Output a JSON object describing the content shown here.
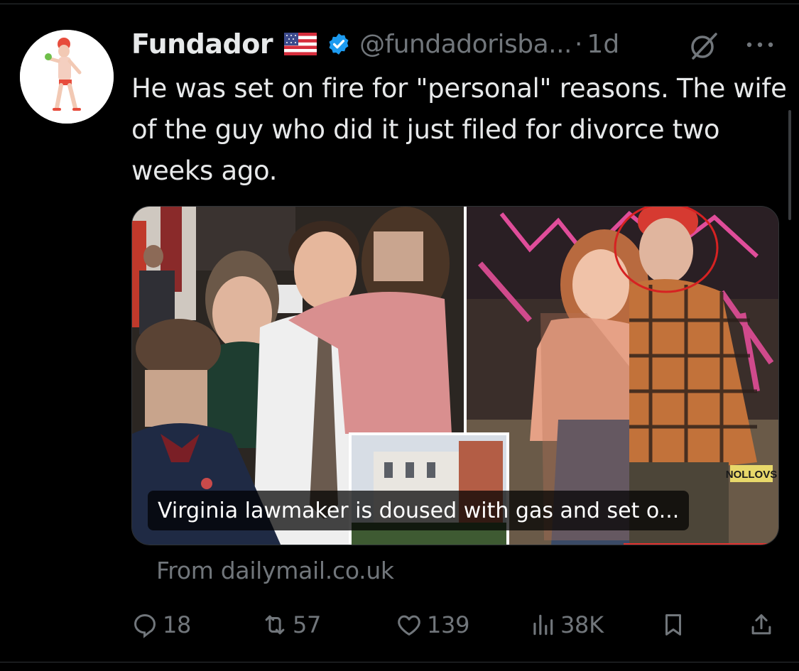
{
  "tweet": {
    "display_name": "Fundador",
    "handle": "@fundadorisba...",
    "separator": "·",
    "time": "1d",
    "text": "He was set on fire for \"personal\" reasons. The wife of the guy who did it just filed for divorce two weeks ago.",
    "icons": [
      "us-flag-icon",
      "verified-badge-icon",
      "grok-icon",
      "more-icon"
    ]
  },
  "link_card": {
    "caption": "Virginia lawmaker is doused with gas and set o...",
    "source": "From dailymail.co.uk",
    "image_sign_text": "NOLLOVS"
  },
  "actions": {
    "replies": "18",
    "reposts": "57",
    "likes": "139",
    "views": "38K"
  },
  "colors": {
    "background": "#000000",
    "text_primary": "#e7e9ea",
    "text_secondary": "#71767b",
    "verified_blue": "#1d9bf0",
    "divider": "#2f3336"
  }
}
